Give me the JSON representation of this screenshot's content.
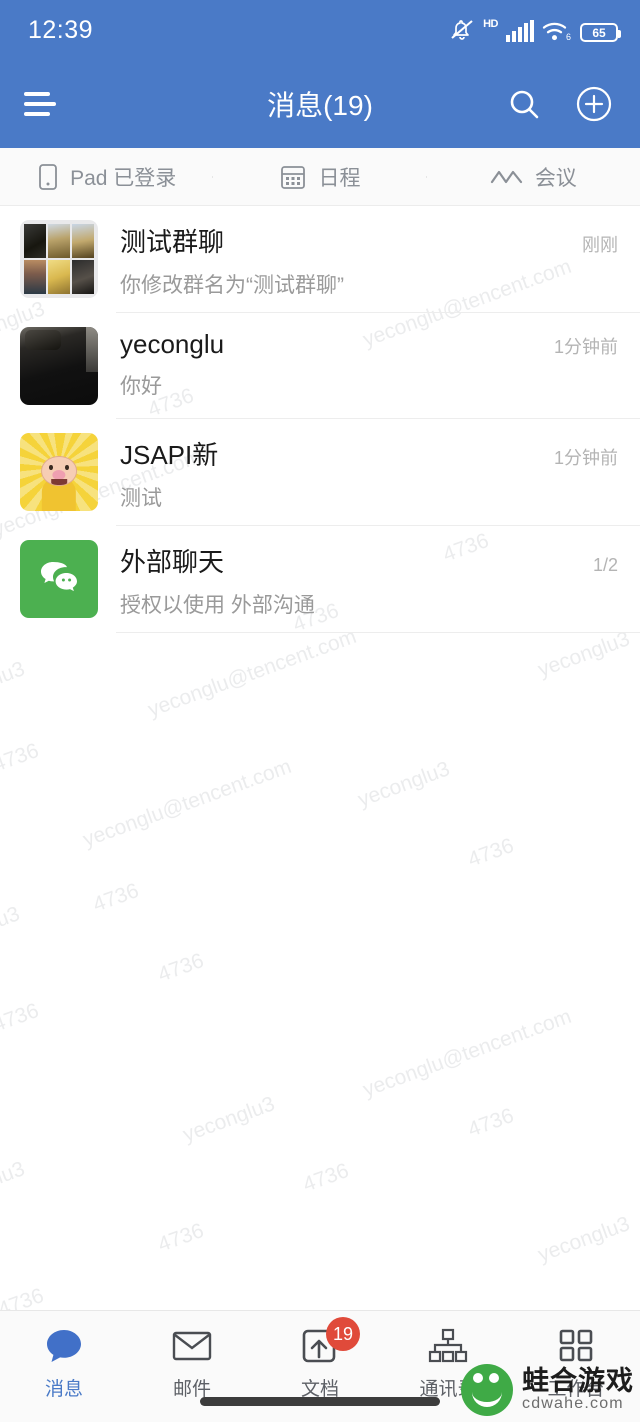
{
  "status_bar": {
    "time": "12:39",
    "hd_label": "HD",
    "battery_level": "65",
    "icons": [
      "bell-muted-icon",
      "hd-icon",
      "signal-icon",
      "wifi6-icon",
      "battery-icon"
    ]
  },
  "header": {
    "title": "消息(19)",
    "menu_icon": "hamburger-menu-icon",
    "search_icon": "search-icon",
    "add_icon": "add-circle-icon",
    "background_color": "#4A7AC7"
  },
  "quick_tabs": [
    {
      "label": "Pad 已登录",
      "icon": "tablet-icon"
    },
    {
      "label": "日程",
      "icon": "calendar-icon"
    },
    {
      "label": "会议",
      "icon": "meeting-icon"
    }
  ],
  "chats": [
    {
      "title": "测试群聊",
      "subtitle": "你修改群名为“测试群聊”",
      "time": "刚刚",
      "avatar_type": "group-photo-grid"
    },
    {
      "title": "yeconglu",
      "subtitle": "你好",
      "time": "1分钟前",
      "avatar_type": "person-photo"
    },
    {
      "title": "JSAPI新",
      "subtitle": "测试",
      "time": "1分钟前",
      "avatar_type": "sunburst-pig"
    },
    {
      "title": "外部聊天",
      "subtitle": "授权以使用 外部沟通",
      "time": "1/2",
      "avatar_type": "wechat-green"
    }
  ],
  "bottom_nav": [
    {
      "label": "消息",
      "icon": "chat-bubble-icon",
      "active": true,
      "badge": ""
    },
    {
      "label": "邮件",
      "icon": "envelope-icon",
      "active": false,
      "badge": ""
    },
    {
      "label": "文档",
      "icon": "document-icon",
      "active": false,
      "badge": "19"
    },
    {
      "label": "通讯录",
      "icon": "org-chart-icon",
      "active": false,
      "badge": ""
    },
    {
      "label": "工作台",
      "icon": "grid-apps-icon",
      "active": false,
      "badge": ""
    }
  ],
  "watermark": {
    "texts": [
      "yeconglu3",
      "4736",
      "yeconglu@tencent.com"
    ],
    "color": "#bfc2c7"
  },
  "site_logo": {
    "name_cn": "蛙合游戏",
    "name_en": "cdwahe.com"
  },
  "colors": {
    "accent": "#4A7AC7",
    "badge": "#e04a3a",
    "green": "#4CB050"
  }
}
